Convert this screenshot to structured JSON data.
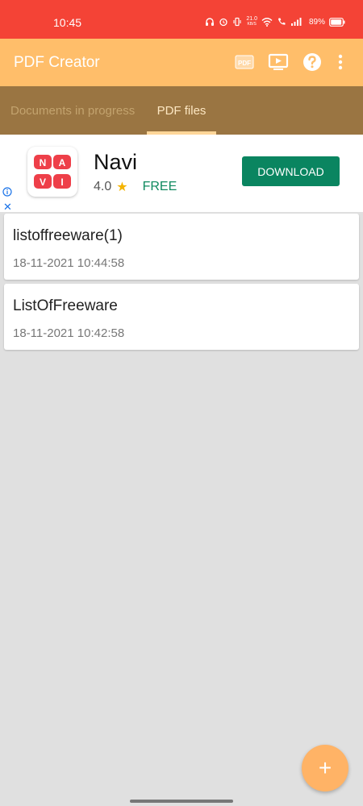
{
  "status_bar": {
    "time": "10:45",
    "net_speed_value": "21.0",
    "net_speed_unit": "KB/S",
    "battery": "89%"
  },
  "app_bar": {
    "title": "PDF Creator",
    "pdf_icon_label": "PDF",
    "actions": [
      "pdf-icon",
      "slideshow-icon",
      "help-icon",
      "more-vert-icon"
    ],
    "background": "#ffbe6a"
  },
  "tabs": {
    "items": [
      {
        "label": "Documents in progress",
        "selected": false
      },
      {
        "label": "PDF files",
        "selected": true
      }
    ],
    "background": "#9a7542"
  },
  "ad": {
    "app_name": "Navi",
    "logo_letters": [
      "N",
      "A",
      "V",
      "I"
    ],
    "rating": "4.0",
    "price": "FREE",
    "cta": "DOWNLOAD",
    "info_icon": "info-icon",
    "close_glyph": "✕",
    "cta_color": "#0a8560"
  },
  "files": [
    {
      "name": "listoffreeware(1)",
      "date": "18-11-2021 10:44:58"
    },
    {
      "name": "ListOfFreeware",
      "date": "18-11-2021 10:42:58"
    }
  ],
  "fab": {
    "icon": "+",
    "color": "#ffb366"
  }
}
